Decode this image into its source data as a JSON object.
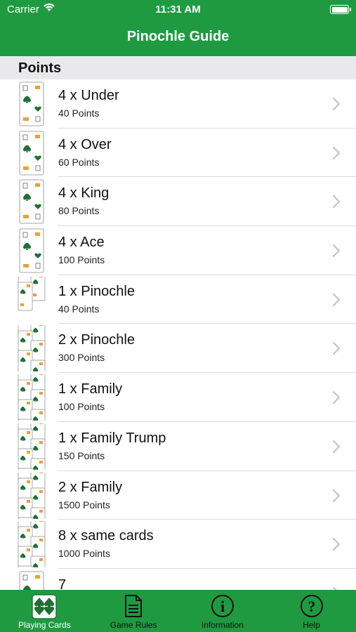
{
  "status_bar": {
    "carrier": "Carrier",
    "time": "11:31 AM"
  },
  "nav": {
    "title": "Pinochle Guide"
  },
  "section": {
    "header": "Points"
  },
  "rows": [
    {
      "title": "4 x Under",
      "subtitle": "40 Points"
    },
    {
      "title": "4 x Over",
      "subtitle": "60 Points"
    },
    {
      "title": "4 x King",
      "subtitle": "80 Points"
    },
    {
      "title": "4 x Ace",
      "subtitle": "100 Points"
    },
    {
      "title": "1 x Pinochle",
      "subtitle": "40 Points"
    },
    {
      "title": "2 x Pinochle",
      "subtitle": "300 Points"
    },
    {
      "title": "1 x Family",
      "subtitle": "100 Points"
    },
    {
      "title": "1 x Family Trump",
      "subtitle": "150 Points"
    },
    {
      "title": "2 x Family",
      "subtitle": "1500 Points"
    },
    {
      "title": "8 x same cards",
      "subtitle": "1000 Points"
    },
    {
      "title": "7",
      "subtitle": ""
    }
  ],
  "tabs": [
    {
      "label": "Playing Cards",
      "icon": "playing-cards-icon",
      "selected": true
    },
    {
      "label": "Game Rules",
      "icon": "document-icon",
      "selected": false
    },
    {
      "label": "Information",
      "icon": "info-icon",
      "selected": false
    },
    {
      "label": "Help",
      "icon": "help-icon",
      "selected": false
    }
  ],
  "colors": {
    "brand_green": "#1f9a41",
    "section_bg": "#e9e9eb",
    "separator": "#dcdcdc"
  }
}
